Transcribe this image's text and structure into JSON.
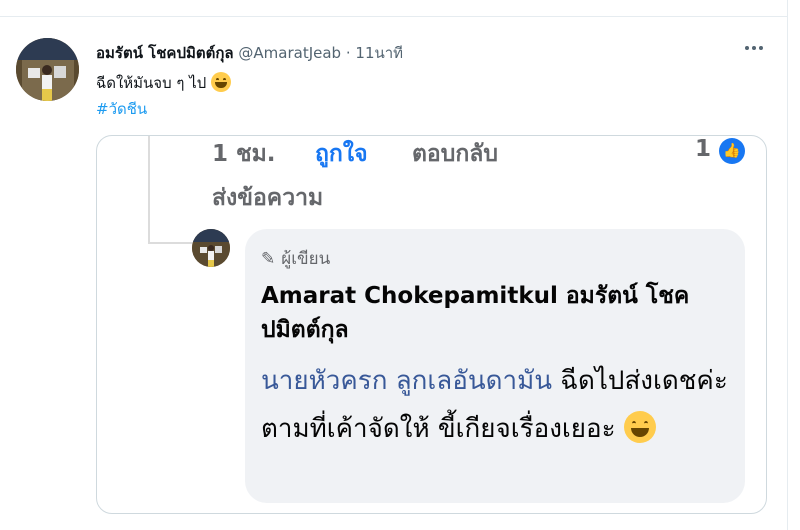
{
  "tweet": {
    "author_name": "อมรัตน์ โชคปมิตต์กุล",
    "author_handle": "@AmaratJeab",
    "separator": "·",
    "timestamp": "11นาที",
    "text": "ฉีดให้มันจบ ๆ ไป",
    "hashtag": "#วัดชีน"
  },
  "media": {
    "comment_meta": {
      "time": "1 ชม.",
      "like_label": "ถูกใจ",
      "reply_label": "ตอบกลับ",
      "reaction_count": "1"
    },
    "send_message": "ส่งข้อความ",
    "reply": {
      "author_badge": "ผู้เขียน",
      "author_name": "Amarat Chokepamitkul อมรัตน์ โชคปมิตต์กุล",
      "mentions": "นายหัวครก ลูกเลอันดามัน",
      "body": "ฉีดไปส่งเดชค่ะ ตามที่เค้าจัดให้ ขี้เกียจเรื่องเยอะ"
    }
  },
  "colors": {
    "link": "#1d9bf0",
    "fb_blue": "#1877f2",
    "mention": "#385898",
    "bubble": "#f0f2f5"
  },
  "icons": [
    "more-icon",
    "grinning-emoji-icon",
    "like-reaction-icon",
    "pencil-icon"
  ]
}
